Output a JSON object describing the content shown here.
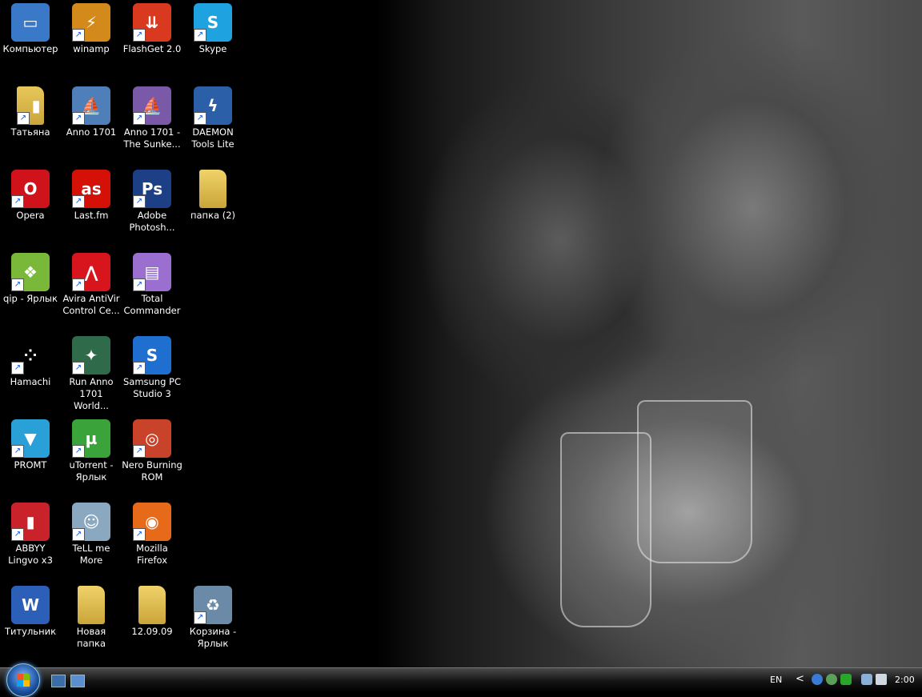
{
  "desktop": {
    "icons": [
      {
        "label": "Компьютер",
        "icon": "computer-icon",
        "col": 0,
        "row": 0,
        "color": "#3a78c8",
        "glyph": "▭",
        "shortcut": false
      },
      {
        "label": "winamp",
        "icon": "winamp-icon",
        "col": 1,
        "row": 0,
        "color": "#d48a1a",
        "glyph": "⚡",
        "shortcut": true
      },
      {
        "label": "FlashGet 2.0",
        "icon": "flashget-icon",
        "col": 2,
        "row": 0,
        "color": "#d93a1f",
        "glyph": "⇊",
        "shortcut": true
      },
      {
        "label": "Skype",
        "icon": "skype-icon",
        "col": 3,
        "row": 0,
        "color": "#1fa3e0",
        "glyph": "S",
        "shortcut": true
      },
      {
        "label": "Татьяна",
        "icon": "folder-icon",
        "col": 0,
        "row": 1,
        "color": "#e8c85a",
        "glyph": "▮",
        "shortcut": true
      },
      {
        "label": "Anno 1701",
        "icon": "anno-icon",
        "col": 1,
        "row": 1,
        "color": "#4f7fb8",
        "glyph": "⛵",
        "shortcut": true
      },
      {
        "label": "Anno 1701 - The Sunke...",
        "icon": "anno-sunken-icon",
        "col": 2,
        "row": 1,
        "color": "#7a5aa8",
        "glyph": "⛵",
        "shortcut": true
      },
      {
        "label": "DAEMON Tools Lite",
        "icon": "daemon-tools-icon",
        "col": 3,
        "row": 1,
        "color": "#2b5fa8",
        "glyph": "ϟ",
        "shortcut": true
      },
      {
        "label": "Opera",
        "icon": "opera-icon",
        "col": 0,
        "row": 2,
        "color": "#d0121b",
        "glyph": "O",
        "shortcut": true
      },
      {
        "label": "Last.fm",
        "icon": "lastfm-icon",
        "col": 1,
        "row": 2,
        "color": "#d51007",
        "glyph": "as",
        "shortcut": true
      },
      {
        "label": "Adobe Photosh...",
        "icon": "photoshop-icon",
        "col": 2,
        "row": 2,
        "color": "#1c3f86",
        "glyph": "Ps",
        "shortcut": true
      },
      {
        "label": "папка (2)",
        "icon": "folder-icon",
        "col": 3,
        "row": 2,
        "color": "#f0d36a",
        "glyph": "",
        "shortcut": false
      },
      {
        "label": "qip - Ярлык",
        "icon": "qip-icon",
        "col": 0,
        "row": 3,
        "color": "#7ab83a",
        "glyph": "❖",
        "shortcut": true
      },
      {
        "label": "Avira AntiVir Control Ce...",
        "icon": "avira-icon",
        "col": 1,
        "row": 3,
        "color": "#d8141c",
        "glyph": "⋀",
        "shortcut": true
      },
      {
        "label": "Total Commander",
        "icon": "total-commander-icon",
        "col": 2,
        "row": 3,
        "color": "#9b6fcf",
        "glyph": "▤",
        "shortcut": true
      },
      {
        "label": "Hamachi",
        "icon": "hamachi-icon",
        "col": 0,
        "row": 4,
        "color": "#000000",
        "glyph": "⁘",
        "shortcut": true
      },
      {
        "label": "Run Anno 1701 World...",
        "icon": "anno-world-icon",
        "col": 1,
        "row": 4,
        "color": "#2f6a4a",
        "glyph": "✦",
        "shortcut": true
      },
      {
        "label": "Samsung PC Studio 3",
        "icon": "samsung-pc-studio-icon",
        "col": 2,
        "row": 4,
        "color": "#1f6fd1",
        "glyph": "S",
        "shortcut": true
      },
      {
        "label": "PROMT",
        "icon": "promt-icon",
        "col": 0,
        "row": 5,
        "color": "#2aa0d8",
        "glyph": "▼",
        "shortcut": true
      },
      {
        "label": "uTorrent - Ярлык",
        "icon": "utorrent-icon",
        "col": 1,
        "row": 5,
        "color": "#3aa33a",
        "glyph": "µ",
        "shortcut": true
      },
      {
        "label": "Nero Burning ROM",
        "icon": "nero-icon",
        "col": 2,
        "row": 5,
        "color": "#c8432a",
        "glyph": "◎",
        "shortcut": true
      },
      {
        "label": "ABBYY Lingvo x3",
        "icon": "lingvo-icon",
        "col": 0,
        "row": 6,
        "color": "#c9222a",
        "glyph": "▮",
        "shortcut": true
      },
      {
        "label": "TeLL me More",
        "icon": "tell-me-more-icon",
        "col": 1,
        "row": 6,
        "color": "#8aa8c0",
        "glyph": "☺",
        "shortcut": true
      },
      {
        "label": "Mozilla Firefox",
        "icon": "firefox-icon",
        "col": 2,
        "row": 6,
        "color": "#e66a1a",
        "glyph": "◉",
        "shortcut": true
      },
      {
        "label": "Титульник",
        "icon": "word-document-icon",
        "col": 0,
        "row": 7,
        "color": "#2b5fb8",
        "glyph": "W",
        "shortcut": false
      },
      {
        "label": "Новая папка",
        "icon": "folder-icon",
        "col": 1,
        "row": 7,
        "color": "#f0d36a",
        "glyph": "",
        "shortcut": false
      },
      {
        "label": "12.09.09",
        "icon": "folder-icon",
        "col": 2,
        "row": 7,
        "color": "#f0d36a",
        "glyph": "",
        "shortcut": false
      },
      {
        "label": "Корзина - Ярлык",
        "icon": "recycle-bin-icon",
        "col": 3,
        "row": 7,
        "color": "#6a8aa8",
        "glyph": "♻",
        "shortcut": true
      }
    ]
  },
  "taskbar": {
    "language": "EN",
    "clock": "2:00",
    "chevron": "<"
  }
}
